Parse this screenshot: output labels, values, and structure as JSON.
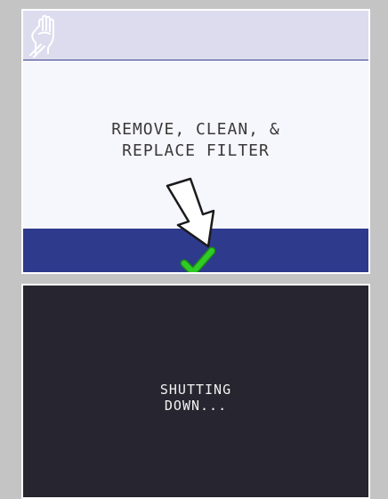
{
  "top_screen": {
    "message_line1": "REMOVE, CLEAN, &",
    "message_line2": "REPLACE FILTER",
    "header_icon": "hand-icon",
    "confirm_icon": "checkmark-icon",
    "pointer_icon": "arrow-icon"
  },
  "bottom_screen": {
    "status_line1": "SHUTTING",
    "status_line2": "DOWN..."
  },
  "colors": {
    "frame": "#c4c4c4",
    "header_bg": "#dcdcee",
    "header_rule": "#3a3f8c",
    "screen_bg": "#f6f6fd",
    "confirm_bar": "#2e3a8c",
    "checkmark": "#2fcc25",
    "dark_screen_bg": "#272630",
    "dark_screen_text": "#f2f2f2"
  }
}
